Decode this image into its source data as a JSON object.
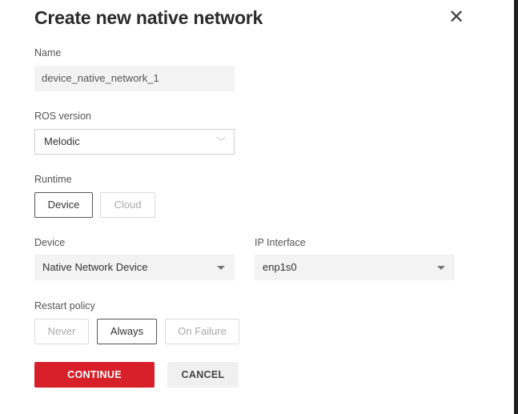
{
  "dialog": {
    "title": "Create new native network",
    "close_icon": "close-icon"
  },
  "name": {
    "label": "Name",
    "value": "device_native_network_1"
  },
  "ros_version": {
    "label": "ROS version",
    "selected": "Melodic",
    "icon": "chevron-down-icon"
  },
  "runtime": {
    "label": "Runtime",
    "options": [
      "Device",
      "Cloud"
    ],
    "selected": "Device"
  },
  "device": {
    "label": "Device",
    "selected": "Native Network Device"
  },
  "ip_interface": {
    "label": "IP Interface",
    "selected": "enp1s0"
  },
  "restart_policy": {
    "label": "Restart policy",
    "options": [
      "Never",
      "Always",
      "On Failure"
    ],
    "selected": "Always"
  },
  "actions": {
    "continue_label": "CONTINUE",
    "cancel_label": "CANCEL"
  },
  "colors": {
    "primary": "#d7202a",
    "field_bg": "#f3f3f3"
  }
}
